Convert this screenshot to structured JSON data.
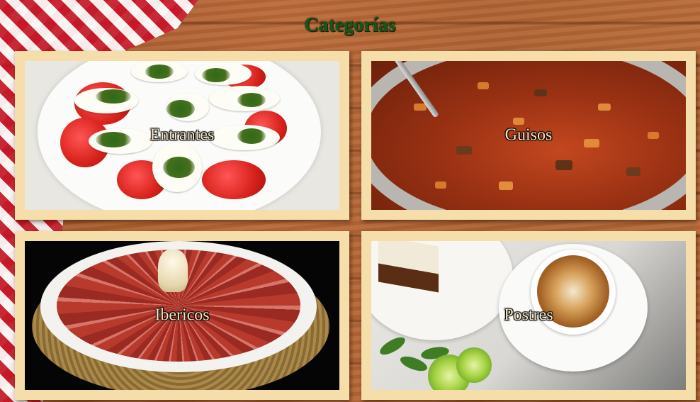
{
  "page": {
    "title": "Categorías"
  },
  "categories": [
    {
      "id": "entrantes",
      "label": "Entrantes",
      "image": "caprese-salad-photo"
    },
    {
      "id": "guisos",
      "label": "Guisos",
      "image": "stew-pot-photo"
    },
    {
      "id": "ibericos",
      "label": "Ibericos",
      "image": "iberian-ham-plate-photo"
    },
    {
      "id": "postres",
      "label": "Postres",
      "image": "dessert-and-coffee-photo"
    }
  ],
  "colors": {
    "title": "#0f5a1a",
    "card_frame": "#f5deaa",
    "label_text": "#f5e6c8"
  }
}
